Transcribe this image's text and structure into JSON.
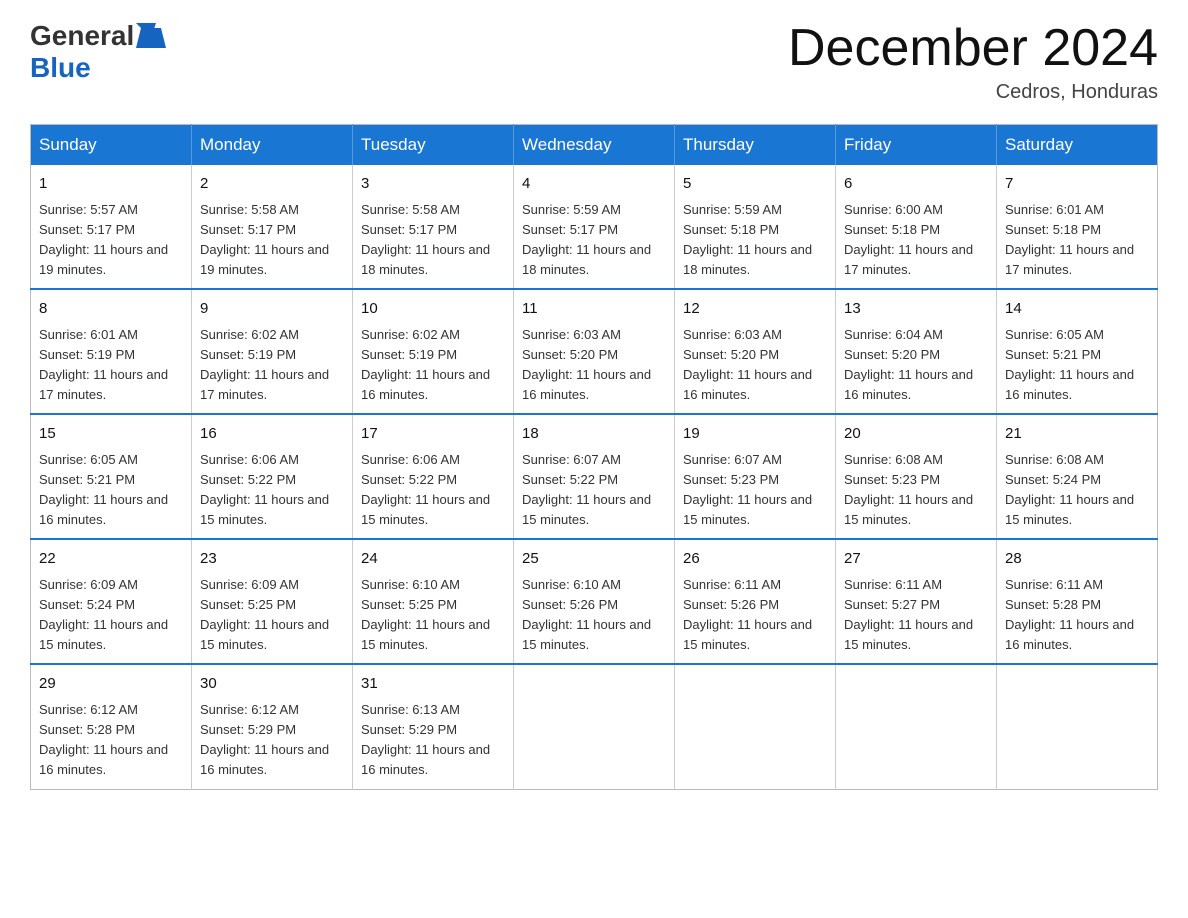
{
  "header": {
    "logo_general": "General",
    "logo_blue": "Blue",
    "month_title": "December 2024",
    "location": "Cedros, Honduras"
  },
  "weekdays": [
    "Sunday",
    "Monday",
    "Tuesday",
    "Wednesday",
    "Thursday",
    "Friday",
    "Saturday"
  ],
  "weeks": [
    [
      {
        "day": "1",
        "sunrise": "5:57 AM",
        "sunset": "5:17 PM",
        "daylight": "11 hours and 19 minutes."
      },
      {
        "day": "2",
        "sunrise": "5:58 AM",
        "sunset": "5:17 PM",
        "daylight": "11 hours and 19 minutes."
      },
      {
        "day": "3",
        "sunrise": "5:58 AM",
        "sunset": "5:17 PM",
        "daylight": "11 hours and 18 minutes."
      },
      {
        "day": "4",
        "sunrise": "5:59 AM",
        "sunset": "5:17 PM",
        "daylight": "11 hours and 18 minutes."
      },
      {
        "day": "5",
        "sunrise": "5:59 AM",
        "sunset": "5:18 PM",
        "daylight": "11 hours and 18 minutes."
      },
      {
        "day": "6",
        "sunrise": "6:00 AM",
        "sunset": "5:18 PM",
        "daylight": "11 hours and 17 minutes."
      },
      {
        "day": "7",
        "sunrise": "6:01 AM",
        "sunset": "5:18 PM",
        "daylight": "11 hours and 17 minutes."
      }
    ],
    [
      {
        "day": "8",
        "sunrise": "6:01 AM",
        "sunset": "5:19 PM",
        "daylight": "11 hours and 17 minutes."
      },
      {
        "day": "9",
        "sunrise": "6:02 AM",
        "sunset": "5:19 PM",
        "daylight": "11 hours and 17 minutes."
      },
      {
        "day": "10",
        "sunrise": "6:02 AM",
        "sunset": "5:19 PM",
        "daylight": "11 hours and 16 minutes."
      },
      {
        "day": "11",
        "sunrise": "6:03 AM",
        "sunset": "5:20 PM",
        "daylight": "11 hours and 16 minutes."
      },
      {
        "day": "12",
        "sunrise": "6:03 AM",
        "sunset": "5:20 PM",
        "daylight": "11 hours and 16 minutes."
      },
      {
        "day": "13",
        "sunrise": "6:04 AM",
        "sunset": "5:20 PM",
        "daylight": "11 hours and 16 minutes."
      },
      {
        "day": "14",
        "sunrise": "6:05 AM",
        "sunset": "5:21 PM",
        "daylight": "11 hours and 16 minutes."
      }
    ],
    [
      {
        "day": "15",
        "sunrise": "6:05 AM",
        "sunset": "5:21 PM",
        "daylight": "11 hours and 16 minutes."
      },
      {
        "day": "16",
        "sunrise": "6:06 AM",
        "sunset": "5:22 PM",
        "daylight": "11 hours and 15 minutes."
      },
      {
        "day": "17",
        "sunrise": "6:06 AM",
        "sunset": "5:22 PM",
        "daylight": "11 hours and 15 minutes."
      },
      {
        "day": "18",
        "sunrise": "6:07 AM",
        "sunset": "5:22 PM",
        "daylight": "11 hours and 15 minutes."
      },
      {
        "day": "19",
        "sunrise": "6:07 AM",
        "sunset": "5:23 PM",
        "daylight": "11 hours and 15 minutes."
      },
      {
        "day": "20",
        "sunrise": "6:08 AM",
        "sunset": "5:23 PM",
        "daylight": "11 hours and 15 minutes."
      },
      {
        "day": "21",
        "sunrise": "6:08 AM",
        "sunset": "5:24 PM",
        "daylight": "11 hours and 15 minutes."
      }
    ],
    [
      {
        "day": "22",
        "sunrise": "6:09 AM",
        "sunset": "5:24 PM",
        "daylight": "11 hours and 15 minutes."
      },
      {
        "day": "23",
        "sunrise": "6:09 AM",
        "sunset": "5:25 PM",
        "daylight": "11 hours and 15 minutes."
      },
      {
        "day": "24",
        "sunrise": "6:10 AM",
        "sunset": "5:25 PM",
        "daylight": "11 hours and 15 minutes."
      },
      {
        "day": "25",
        "sunrise": "6:10 AM",
        "sunset": "5:26 PM",
        "daylight": "11 hours and 15 minutes."
      },
      {
        "day": "26",
        "sunrise": "6:11 AM",
        "sunset": "5:26 PM",
        "daylight": "11 hours and 15 minutes."
      },
      {
        "day": "27",
        "sunrise": "6:11 AM",
        "sunset": "5:27 PM",
        "daylight": "11 hours and 15 minutes."
      },
      {
        "day": "28",
        "sunrise": "6:11 AM",
        "sunset": "5:28 PM",
        "daylight": "11 hours and 16 minutes."
      }
    ],
    [
      {
        "day": "29",
        "sunrise": "6:12 AM",
        "sunset": "5:28 PM",
        "daylight": "11 hours and 16 minutes."
      },
      {
        "day": "30",
        "sunrise": "6:12 AM",
        "sunset": "5:29 PM",
        "daylight": "11 hours and 16 minutes."
      },
      {
        "day": "31",
        "sunrise": "6:13 AM",
        "sunset": "5:29 PM",
        "daylight": "11 hours and 16 minutes."
      },
      null,
      null,
      null,
      null
    ]
  ]
}
